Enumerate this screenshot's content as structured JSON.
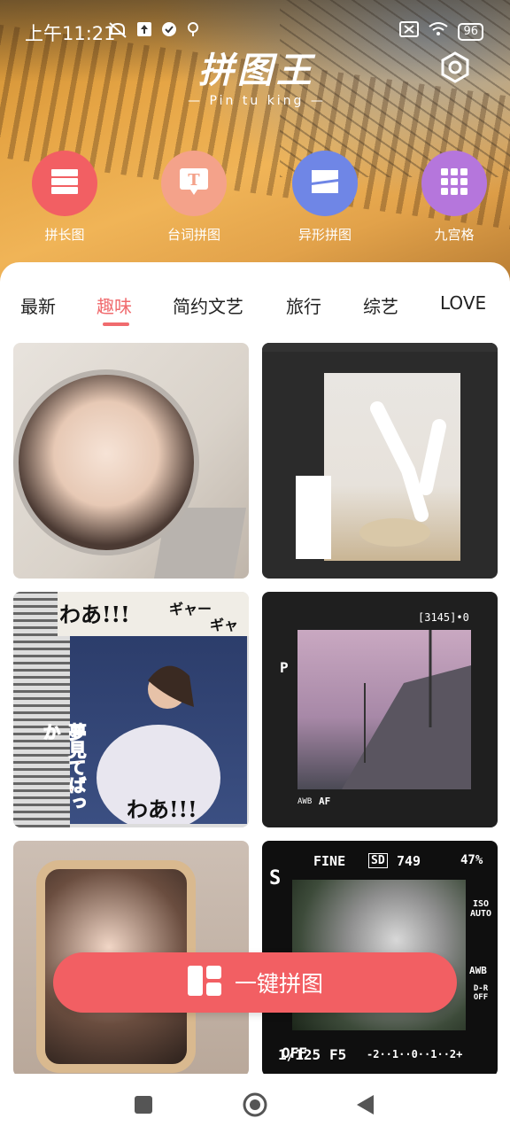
{
  "status_bar": {
    "time": "上午11:21",
    "battery": "96"
  },
  "app": {
    "logo_title": "拼图王",
    "logo_subtitle": "— Pin tu king —"
  },
  "tools": [
    {
      "label": "拼长图",
      "color": "#f25f63",
      "icon": "rows-icon"
    },
    {
      "label": "台词拼图",
      "color": "#f4a28a",
      "icon": "text-bubble-icon"
    },
    {
      "label": "异形拼图",
      "color": "#6f86e6",
      "icon": "shape-icon"
    },
    {
      "label": "九宫格",
      "color": "#b576dc",
      "icon": "nine-grid-icon"
    }
  ],
  "tabs": [
    {
      "label": "最新",
      "active": false
    },
    {
      "label": "趣味",
      "active": true
    },
    {
      "label": "简约文艺",
      "active": false
    },
    {
      "label": "旅行",
      "active": false
    },
    {
      "label": "综艺",
      "active": false
    },
    {
      "label": "LOVE",
      "active": false
    }
  ],
  "cards": {
    "c3": {
      "text_top": "わあ!!!",
      "text_gya": "ギャー",
      "text_gya2": "ギャ",
      "text_red": "夢見てばっか",
      "text_bottom": "わあ!!!"
    },
    "c4": {
      "top": "[3145]•0",
      "mode": "P",
      "awb": "AWB",
      "af": "AF"
    },
    "c6": {
      "fine": "FINE",
      "sd": "SD",
      "count": "749",
      "pct": "47%",
      "s": "S",
      "iso": "ISO AUTO",
      "awb": "AWB",
      "dr": "D-R OFF",
      "shutter": "1/125",
      "aperture": "F5",
      "ev": "-2··1··0··1··2+",
      "off": "OFF"
    }
  },
  "cta": {
    "label": "一键拼图"
  },
  "colors": {
    "accent": "#f06b6e",
    "cta": "#f25f63"
  }
}
